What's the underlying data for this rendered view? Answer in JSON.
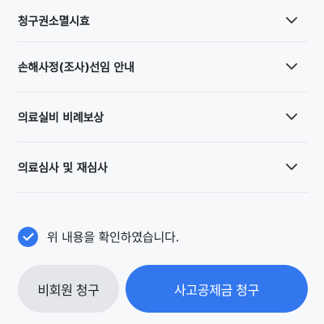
{
  "accordion": {
    "items": [
      {
        "label": "청구권소멸시효"
      },
      {
        "label": "손해사정(조사)선임 안내"
      },
      {
        "label": "의료실비 비례보상"
      },
      {
        "label": "의료심사 및 재심사"
      }
    ]
  },
  "agreement": {
    "checked": true,
    "text": "위 내용을 확인하였습니다."
  },
  "actions": {
    "secondary_label": "비회원 청구",
    "primary_label": "사고공제금 청구"
  },
  "colors": {
    "accent": "#3377ee",
    "secondary_bg": "#e4e6ea",
    "background": "#f7f8fa"
  }
}
